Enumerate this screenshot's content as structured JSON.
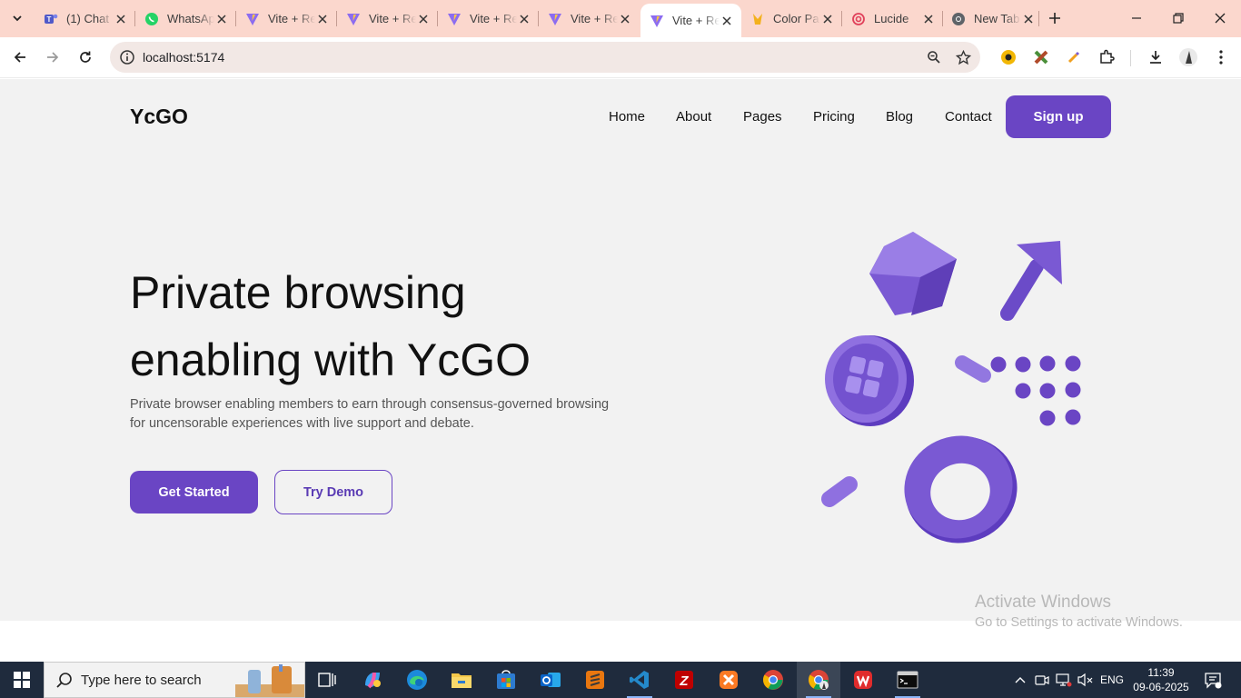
{
  "browser": {
    "tabs": [
      {
        "title": "(1) Chat",
        "icon": "teams-icon",
        "active": false
      },
      {
        "title": "WhatsApp",
        "icon": "whatsapp-icon",
        "active": false
      },
      {
        "title": "Vite + React",
        "icon": "vite-icon",
        "active": false
      },
      {
        "title": "Vite + React",
        "icon": "vite-icon",
        "active": false
      },
      {
        "title": "Vite + React",
        "icon": "vite-icon",
        "active": false
      },
      {
        "title": "Vite + React",
        "icon": "vite-icon",
        "active": false
      },
      {
        "title": "Vite + React",
        "icon": "vite-icon",
        "active": true
      },
      {
        "title": "Color Palette",
        "icon": "colorpalette-icon",
        "active": false
      },
      {
        "title": "Lucide",
        "icon": "lucide-icon",
        "active": false
      },
      {
        "title": "New Tab",
        "icon": "chrome-icon",
        "active": false
      }
    ],
    "url": "localhost:5174",
    "accent_color": "#fbd7cd"
  },
  "site": {
    "logo": "YcGO",
    "nav": [
      "Home",
      "About",
      "Pages",
      "Pricing",
      "Blog",
      "Contact"
    ],
    "signup_label": "Sign up",
    "hero": {
      "title_line1": "Private browsing",
      "title_line2": "enabling with YcGO",
      "subtitle": "Private browser enabling members to earn through consensus-governed browsing for uncensorable experiences with live support and debate.",
      "primary_label": "Get Started",
      "secondary_label": "Try Demo"
    },
    "brand_color": "#6a45c4"
  },
  "watermark": {
    "line1": "Activate Windows",
    "line2": "Go to Settings to activate Windows."
  },
  "taskbar": {
    "search_placeholder": "Type here to search",
    "apps": [
      "task-view-icon",
      "copilot-icon",
      "edge-icon",
      "file-explorer-icon",
      "store-icon",
      "outlook-icon",
      "sublime-icon",
      "vscode-icon",
      "filezilla-icon",
      "xampp-icon",
      "chrome-icon",
      "chrome-profile-icon",
      "wps-icon",
      "terminal-icon"
    ],
    "language": "ENG",
    "time": "11:39",
    "date": "09-06-2025"
  }
}
